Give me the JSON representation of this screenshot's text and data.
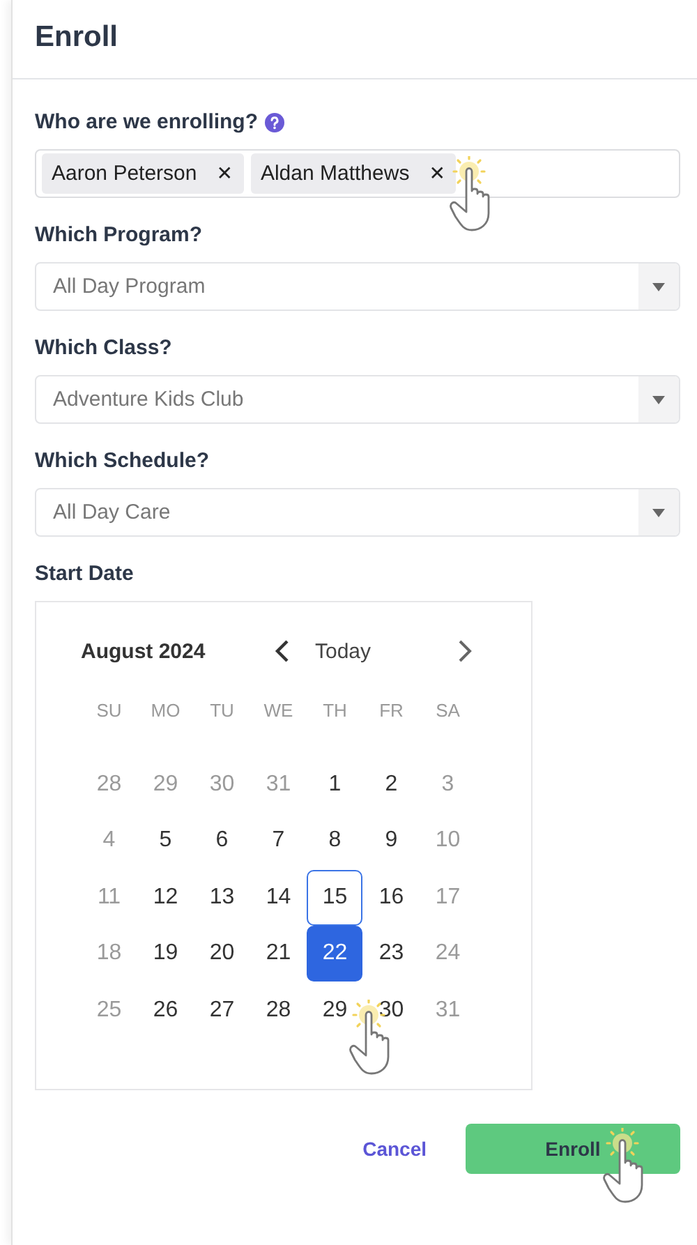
{
  "title": "Enroll",
  "enrollees": {
    "label": "Who are we enrolling?",
    "chips": [
      "Aaron Peterson",
      "Aldan Matthews"
    ],
    "remove_glyph": "✕"
  },
  "selects": [
    {
      "label": "Which Program?",
      "value": "All Day Program"
    },
    {
      "label": "Which Class?",
      "value": "Adventure Kids Club"
    },
    {
      "label": "Which Schedule?",
      "value": "All Day Care"
    }
  ],
  "start_date": {
    "label": "Start Date",
    "month": "August 2024",
    "today_button": "Today",
    "weekdays": [
      "SU",
      "MO",
      "TU",
      "WE",
      "TH",
      "FR",
      "SA"
    ],
    "weeks": [
      [
        {
          "label": "28",
          "muted": true,
          "today": false,
          "selected": false
        },
        {
          "label": "29",
          "muted": true,
          "today": false,
          "selected": false
        },
        {
          "label": "30",
          "muted": true,
          "today": false,
          "selected": false
        },
        {
          "label": "31",
          "muted": true,
          "today": false,
          "selected": false
        },
        {
          "label": "1",
          "muted": false,
          "today": false,
          "selected": false
        },
        {
          "label": "2",
          "muted": false,
          "today": false,
          "selected": false
        },
        {
          "label": "3",
          "muted": true,
          "today": false,
          "selected": false
        }
      ],
      [
        {
          "label": "4",
          "muted": true,
          "today": false,
          "selected": false
        },
        {
          "label": "5",
          "muted": false,
          "today": false,
          "selected": false
        },
        {
          "label": "6",
          "muted": false,
          "today": false,
          "selected": false
        },
        {
          "label": "7",
          "muted": false,
          "today": false,
          "selected": false
        },
        {
          "label": "8",
          "muted": false,
          "today": false,
          "selected": false
        },
        {
          "label": "9",
          "muted": false,
          "today": false,
          "selected": false
        },
        {
          "label": "10",
          "muted": true,
          "today": false,
          "selected": false
        }
      ],
      [
        {
          "label": "11",
          "muted": true,
          "today": false,
          "selected": false
        },
        {
          "label": "12",
          "muted": false,
          "today": false,
          "selected": false
        },
        {
          "label": "13",
          "muted": false,
          "today": false,
          "selected": false
        },
        {
          "label": "14",
          "muted": false,
          "today": false,
          "selected": false
        },
        {
          "label": "15",
          "muted": false,
          "today": true,
          "selected": false
        },
        {
          "label": "16",
          "muted": false,
          "today": false,
          "selected": false
        },
        {
          "label": "17",
          "muted": true,
          "today": false,
          "selected": false
        }
      ],
      [
        {
          "label": "18",
          "muted": true,
          "today": false,
          "selected": false
        },
        {
          "label": "19",
          "muted": false,
          "today": false,
          "selected": false
        },
        {
          "label": "20",
          "muted": false,
          "today": false,
          "selected": false
        },
        {
          "label": "21",
          "muted": false,
          "today": false,
          "selected": false
        },
        {
          "label": "22",
          "muted": false,
          "today": false,
          "selected": true
        },
        {
          "label": "23",
          "muted": false,
          "today": false,
          "selected": false
        },
        {
          "label": "24",
          "muted": true,
          "today": false,
          "selected": false
        }
      ],
      [
        {
          "label": "25",
          "muted": true,
          "today": false,
          "selected": false
        },
        {
          "label": "26",
          "muted": false,
          "today": false,
          "selected": false
        },
        {
          "label": "27",
          "muted": false,
          "today": false,
          "selected": false
        },
        {
          "label": "28",
          "muted": false,
          "today": false,
          "selected": false
        },
        {
          "label": "29",
          "muted": false,
          "today": false,
          "selected": false
        },
        {
          "label": "30",
          "muted": false,
          "today": false,
          "selected": false
        },
        {
          "label": "31",
          "muted": true,
          "today": false,
          "selected": false
        }
      ]
    ]
  },
  "buttons": {
    "cancel": "Cancel",
    "submit": "Enroll"
  }
}
